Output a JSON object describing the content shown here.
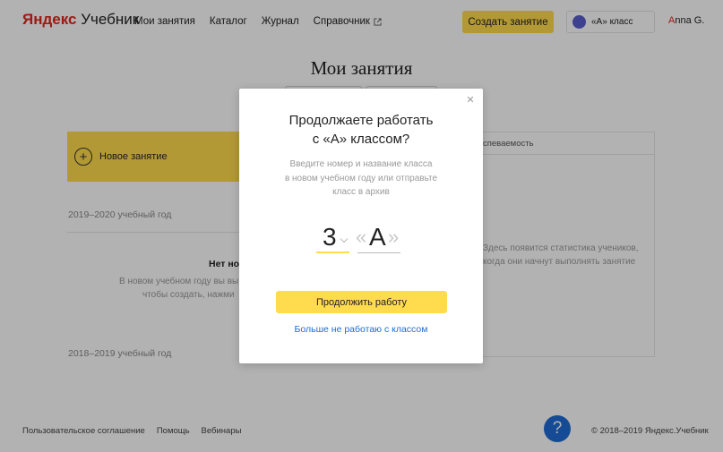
{
  "header": {
    "logo_brand": "Яндекс",
    "logo_product": "Учебник",
    "nav": [
      {
        "label": "Мои занятия"
      },
      {
        "label": "Каталог"
      },
      {
        "label": "Журнал"
      },
      {
        "label": "Справочник",
        "icon": "external-link-icon"
      }
    ],
    "create_button": "Создать занятие",
    "class_selector": "«А» класс",
    "user_first_letter": "A",
    "user_rest": "nna G."
  },
  "main": {
    "title": "Мои занятия",
    "new_lesson": "Новое занятие",
    "years": [
      "2019–2020 учебный год",
      "2018–2019 учебный год"
    ],
    "empty_title": "Нет но",
    "empty_text": [
      "В новом учебном году вы вы",
      "чтобы создать, нажми"
    ],
    "stats_header": "спеваемость",
    "stats_text": [
      "Здесь появится статистика учеников,",
      "когда они начнут выполнять занятие"
    ]
  },
  "modal": {
    "close_icon": "close-icon",
    "title": [
      "Продолжаете работать",
      "с «А» классом?"
    ],
    "description": [
      "Введите номер и название класса",
      "в новом учебном году или отправьте",
      "класс в архив"
    ],
    "grade_number": "3",
    "class_letter": "А",
    "quote_open": "«",
    "quote_close": "»",
    "continue_button": "Продолжить работу",
    "leave_link": "Больше не работаю с классом"
  },
  "footer": {
    "links": [
      "Пользовательское соглашение",
      "Помощь",
      "Вебинары"
    ],
    "copyright": "© 2018–2019 Яндекс.Учебник",
    "help_icon_label": "?"
  },
  "colors": {
    "accent_yellow": "#ffdb4d",
    "link_blue": "#1f6bd6",
    "brand_red": "#e0261c",
    "class_dot": "#5a5ecf"
  }
}
